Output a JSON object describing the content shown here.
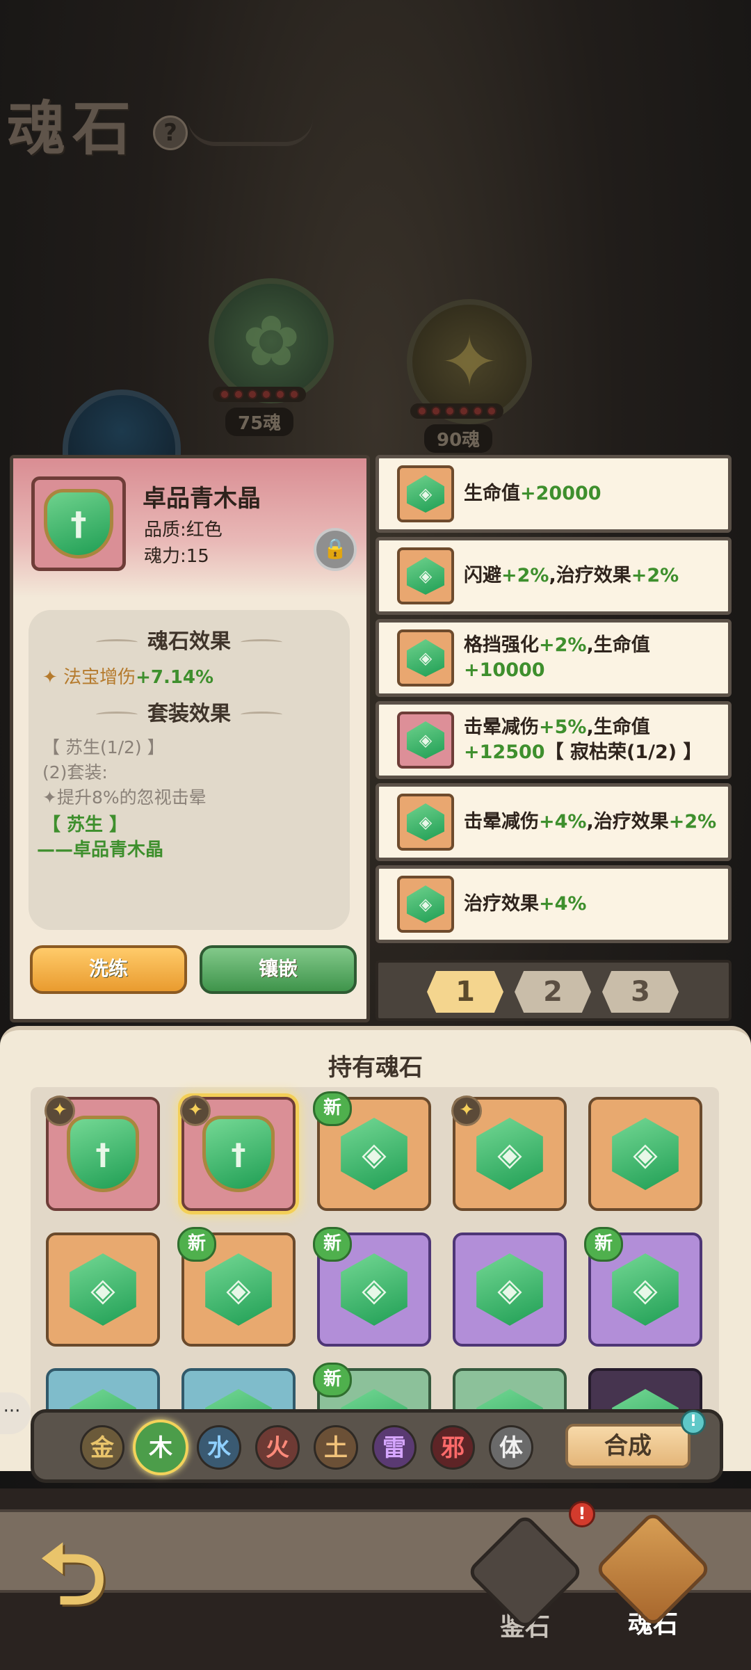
{
  "header": {
    "title": "魂石",
    "help_icon": "?"
  },
  "background_orbs": [
    {
      "label": "75魂",
      "filled_dots": 0,
      "total_dots": 6
    },
    {
      "label": "90魂",
      "filled_dots": 0,
      "total_dots": 6
    }
  ],
  "detail": {
    "name": "卓品青木晶",
    "quality": "品质:红色",
    "power": "魂力:15",
    "lock_icon": "lock-icon",
    "effect_title": "魂石效果",
    "effect_name": "法宝增伤",
    "effect_value": "+7.14%",
    "set_title": "套装效果",
    "set_name": "【 苏生(1/2) 】",
    "set_piece": "(2)套装:",
    "set_desc": "提升8%的忽视击晕",
    "set_name2": "【 苏生 】",
    "set_member": "——卓品青木晶",
    "refine_label": "洗练",
    "inlay_label": "镶嵌"
  },
  "stats": [
    {
      "icon_bg": "orange",
      "parts": [
        {
          "t": "生命值"
        },
        {
          "t": "+20000",
          "g": true
        }
      ]
    },
    {
      "icon_bg": "orange",
      "parts": [
        {
          "t": "闪避"
        },
        {
          "t": "+2%",
          "g": true
        },
        {
          "t": ",治疗效果"
        },
        {
          "t": "+2%",
          "g": true
        }
      ]
    },
    {
      "icon_bg": "orange",
      "parts": [
        {
          "t": "格挡强化"
        },
        {
          "t": "+2%",
          "g": true
        },
        {
          "t": ",生命值"
        },
        {
          "t": "+10000",
          "g": true
        }
      ]
    },
    {
      "icon_bg": "red",
      "parts": [
        {
          "t": "击晕减伤"
        },
        {
          "t": "+5%",
          "g": true
        },
        {
          "t": ",生命值"
        },
        {
          "t": "+12500",
          "g": true
        },
        {
          "t": "【 寂枯荣(1/2) 】"
        }
      ]
    },
    {
      "icon_bg": "orange",
      "parts": [
        {
          "t": "击晕减伤"
        },
        {
          "t": "+4%",
          "g": true
        },
        {
          "t": ",治疗效果"
        },
        {
          "t": "+2%",
          "g": true
        }
      ]
    },
    {
      "icon_bg": "orange",
      "parts": [
        {
          "t": "治疗效果"
        },
        {
          "t": "+4%",
          "g": true
        }
      ]
    }
  ],
  "pager": {
    "pages": [
      "1",
      "2",
      "3"
    ],
    "current": "1"
  },
  "inventory": {
    "title": "持有魂石",
    "new_badge": "新",
    "slots": [
      {
        "bg": "red",
        "shape": "shield",
        "badge": "star"
      },
      {
        "bg": "red",
        "shape": "shield",
        "badge": "star",
        "selected": true
      },
      {
        "bg": "orange",
        "shape": "hex",
        "badge": "new"
      },
      {
        "bg": "orange",
        "shape": "hex",
        "badge": "star"
      },
      {
        "bg": "orange",
        "shape": "hex",
        "badge": ""
      },
      {
        "bg": "orange",
        "shape": "hex",
        "badge": ""
      },
      {
        "bg": "orange",
        "shape": "hex",
        "badge": "new"
      },
      {
        "bg": "purple",
        "shape": "hex",
        "badge": "new"
      },
      {
        "bg": "purple",
        "shape": "hex",
        "badge": ""
      },
      {
        "bg": "purple",
        "shape": "hex",
        "badge": "new"
      },
      {
        "bg": "teal",
        "shape": "hex",
        "badge": ""
      },
      {
        "bg": "teal",
        "shape": "hex",
        "badge": ""
      },
      {
        "bg": "green",
        "shape": "hex",
        "badge": "new"
      },
      {
        "bg": "green",
        "shape": "hex",
        "badge": ""
      },
      {
        "bg": "dark",
        "shape": "hex",
        "badge": ""
      }
    ]
  },
  "filters": {
    "elements": [
      {
        "label": "金",
        "color": "#e9c46b",
        "bg": "#6b5a3a"
      },
      {
        "label": "木",
        "color": "#ffffff",
        "bg": "#4c9d4a",
        "active": true
      },
      {
        "label": "水",
        "color": "#8fd0ff",
        "bg": "#3a5a72"
      },
      {
        "label": "火",
        "color": "#ff8a7a",
        "bg": "#6e3a34"
      },
      {
        "label": "土",
        "color": "#f1c27a",
        "bg": "#6b5036"
      },
      {
        "label": "雷",
        "color": "#d6a6ff",
        "bg": "#5a3a72"
      },
      {
        "label": "邪",
        "color": "#ff6a6a",
        "bg": "#5e2426"
      },
      {
        "label": "体",
        "color": "#f0f0f0",
        "bg": "#6a6a6a"
      }
    ],
    "synth_label": "合成",
    "synth_alert": "!"
  },
  "chat_icon": "···",
  "nav": {
    "back_icon": "back-arrow-icon",
    "items": [
      {
        "label": "鉴石",
        "alert": "!"
      },
      {
        "label": "魂石"
      }
    ]
  }
}
